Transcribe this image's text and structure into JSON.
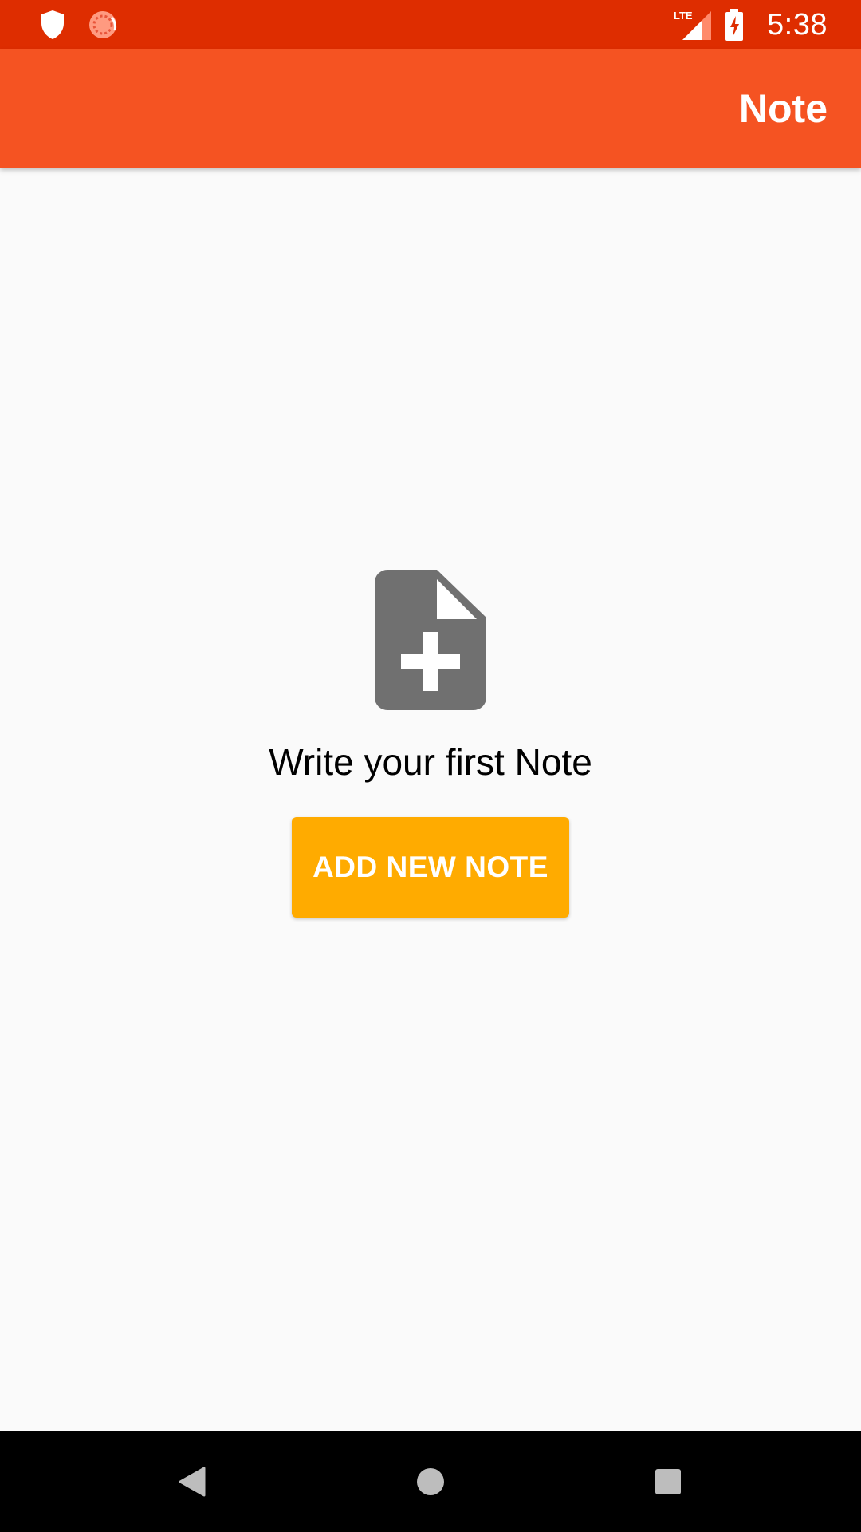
{
  "status_bar": {
    "time": "5:38",
    "network": "LTE",
    "left_icons": [
      "shield-icon",
      "sync-icon"
    ],
    "right_icons": [
      "lte-signal-icon",
      "battery-charging-icon"
    ],
    "background": "#de2d00"
  },
  "app_bar": {
    "title": "Note",
    "background": "#f55322"
  },
  "empty_state": {
    "icon": "note-add-icon",
    "message": "Write your first Note",
    "button_label": "ADD NEW NOTE",
    "button_color": "#ffab00"
  },
  "nav_bar": {
    "buttons": [
      "back-icon",
      "home-icon",
      "recents-icon"
    ]
  }
}
